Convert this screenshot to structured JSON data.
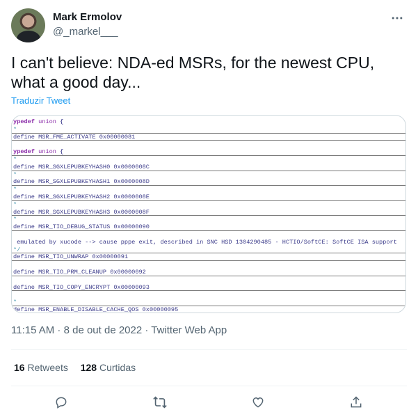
{
  "author": {
    "name": "Mark Ermolov",
    "handle": "@_markel___"
  },
  "tweet": {
    "text": "I can't believe: NDA-ed MSRs, for the newest CPU, what a good day...",
    "translate": "Traduzir Tweet",
    "timestamp": "11:15 AM · 8 de out de 2022 · Twitter Web App"
  },
  "code_lines": [
    {
      "type": "kw",
      "kw": "ypedef",
      "rest": "union",
      "tail": " {"
    },
    {
      "type": "cm",
      "text": "*",
      "sep": true
    },
    {
      "type": "plain",
      "text": "define MSR_FME_ACTIVATE 0x00000081",
      "sep": true
    },
    {
      "type": "gap"
    },
    {
      "type": "kw",
      "kw": "ypedef",
      "rest": "union",
      "tail": " {",
      "sep": true
    },
    {
      "type": "cm",
      "text": "*",
      "sep": false
    },
    {
      "type": "plain",
      "text": "define MSR_SGXLEPUBKEYHASH0 0x0000008C",
      "sep": true
    },
    {
      "type": "cm",
      "text": "*"
    },
    {
      "type": "plain",
      "text": "define MSR_SGXLEPUBKEYHASH1 0x0000008D",
      "sep": true
    },
    {
      "type": "cm",
      "text": "*"
    },
    {
      "type": "plain",
      "text": "define MSR_SGXLEPUBKEYHASH2 0x0000008E",
      "sep": true
    },
    {
      "type": "cm",
      "text": "*"
    },
    {
      "type": "plain",
      "text": "define MSR_SGXLEPUBKEYHASH3 0x0000008F",
      "sep": true
    },
    {
      "type": "cm",
      "text": "*"
    },
    {
      "type": "plain",
      "text": "define MSR_TIO_DEBUG_STATUS 0x00000090",
      "sep": true
    },
    {
      "type": "gap"
    },
    {
      "type": "plain",
      "text": " emulated by xucode --> cause pppe exit, described in SNC HSD 1304290485 - HCTIO/SoftCE: SoftCE ISA support"
    },
    {
      "type": "cm",
      "text": "*/",
      "sep": true
    },
    {
      "type": "plain",
      "text": "define MSR_TIO_UNWRAP 0x00000091",
      "sep": true
    },
    {
      "type": "gap"
    },
    {
      "type": "plain",
      "text": "define MSR_TIO_PRM_CLEANUP 0x00000092",
      "sep": true
    },
    {
      "type": "gap"
    },
    {
      "type": "plain",
      "text": "define MSR_TIO_COPY_ENCRYPT 0x00000093",
      "sep": true
    },
    {
      "type": "gap"
    },
    {
      "type": "cm",
      "text": "*",
      "sep": true
    },
    {
      "type": "plain",
      "text": "define MSR_ENABLE_DISABLE_CACHE_QOS 0x00000095",
      "sep": true
    }
  ],
  "stats": {
    "retweets_count": "16",
    "retweets_label": "Retweets",
    "likes_count": "128",
    "likes_label": "Curtidas"
  },
  "icons": {
    "more": "more-icon",
    "reply": "reply-icon",
    "retweet": "retweet-icon",
    "like": "like-icon",
    "share": "share-icon"
  },
  "colors": {
    "link": "#1d9bf0",
    "secondary": "#536471",
    "text": "#0f1419"
  }
}
